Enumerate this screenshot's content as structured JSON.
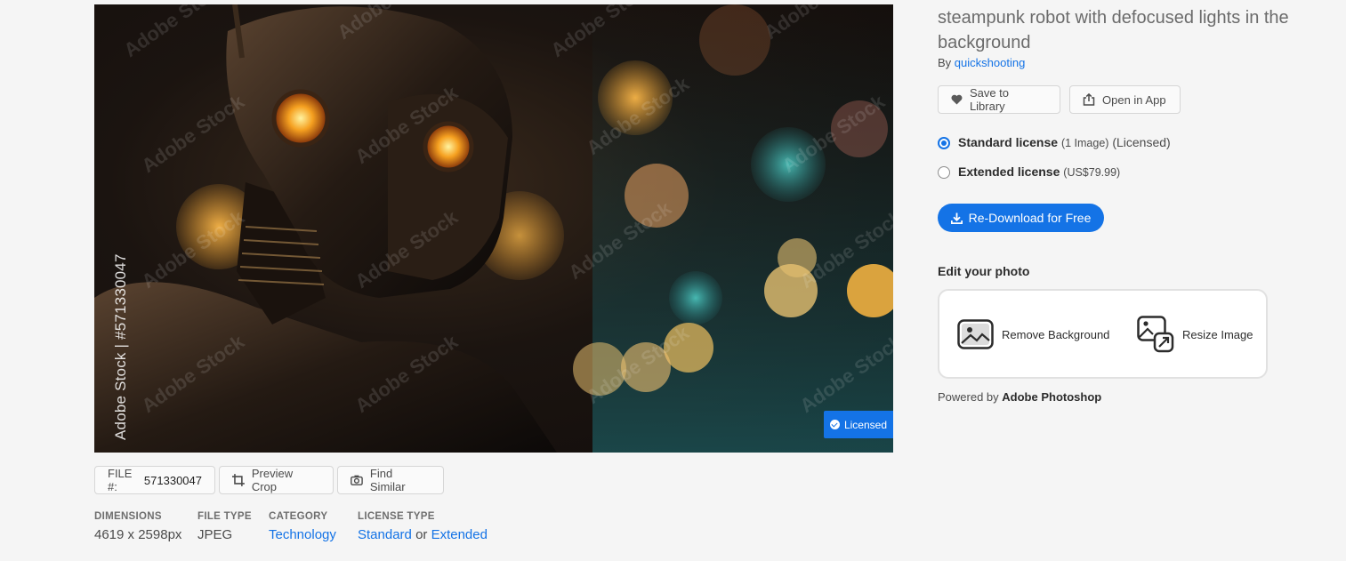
{
  "image": {
    "stock_id_text": "Adobe Stock | #571330047",
    "watermark": "Adobe Stock",
    "licensed_badge": "Licensed"
  },
  "actions": {
    "file_label": "FILE #:",
    "file_number": "571330047",
    "preview_crop": "Preview Crop",
    "find_similar": "Find Similar"
  },
  "meta": {
    "dimensions_label": "DIMENSIONS",
    "dimensions_value": "4619 x 2598px",
    "file_type_label": "FILE TYPE",
    "file_type_value": "JPEG",
    "category_label": "CATEGORY",
    "category_value": "Technology",
    "license_type_label": "LICENSE TYPE",
    "license_standard": "Standard",
    "license_or": "or",
    "license_extended": "Extended"
  },
  "panel": {
    "title": "steampunk robot with defocused lights in the background",
    "by_prefix": "By",
    "author": "quickshooting",
    "save_to_library": "Save to Library",
    "open_in_app": "Open in App",
    "standard_license": "Standard license",
    "standard_detail": "(1 Image)",
    "standard_status": "(Licensed)",
    "extended_license": "Extended license",
    "extended_price": "(US$79.99)",
    "redownload": "Re-Download for Free",
    "edit_heading": "Edit your photo",
    "remove_background": "Remove Background",
    "resize_image": "Resize Image",
    "powered_prefix": "Powered by",
    "powered_product": "Adobe Photoshop"
  },
  "colors": {
    "accent": "#1473e6",
    "background": "#f5f5f5"
  }
}
